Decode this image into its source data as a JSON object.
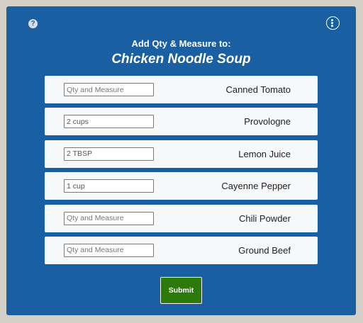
{
  "header": {
    "help_glyph": "?",
    "subtitle": "Add Qty & Measure to:",
    "recipe_title": "Chicken Noodle Soup"
  },
  "colors": {
    "dialog_bg": "#1a5fa1",
    "row_bg": "#f7f8fa",
    "submit_bg": "#2b7a0b"
  },
  "rows": [
    {
      "ingredient": "Canned Tomato",
      "value": "",
      "placeholder": "Qty and Measure"
    },
    {
      "ingredient": "Provologne",
      "value": "2 cups",
      "placeholder": "Qty and Measure"
    },
    {
      "ingredient": "Lemon Juice",
      "value": "2 TBSP",
      "placeholder": "Qty and Measure"
    },
    {
      "ingredient": "Cayenne Pepper",
      "value": "1 cup",
      "placeholder": "Qty and Measure"
    },
    {
      "ingredient": "Chili Powder",
      "value": "",
      "placeholder": "Qty and Measure"
    },
    {
      "ingredient": "Ground Beef",
      "value": "",
      "placeholder": "Qty and Measure"
    }
  ],
  "footer": {
    "submit_label": "Submit"
  }
}
